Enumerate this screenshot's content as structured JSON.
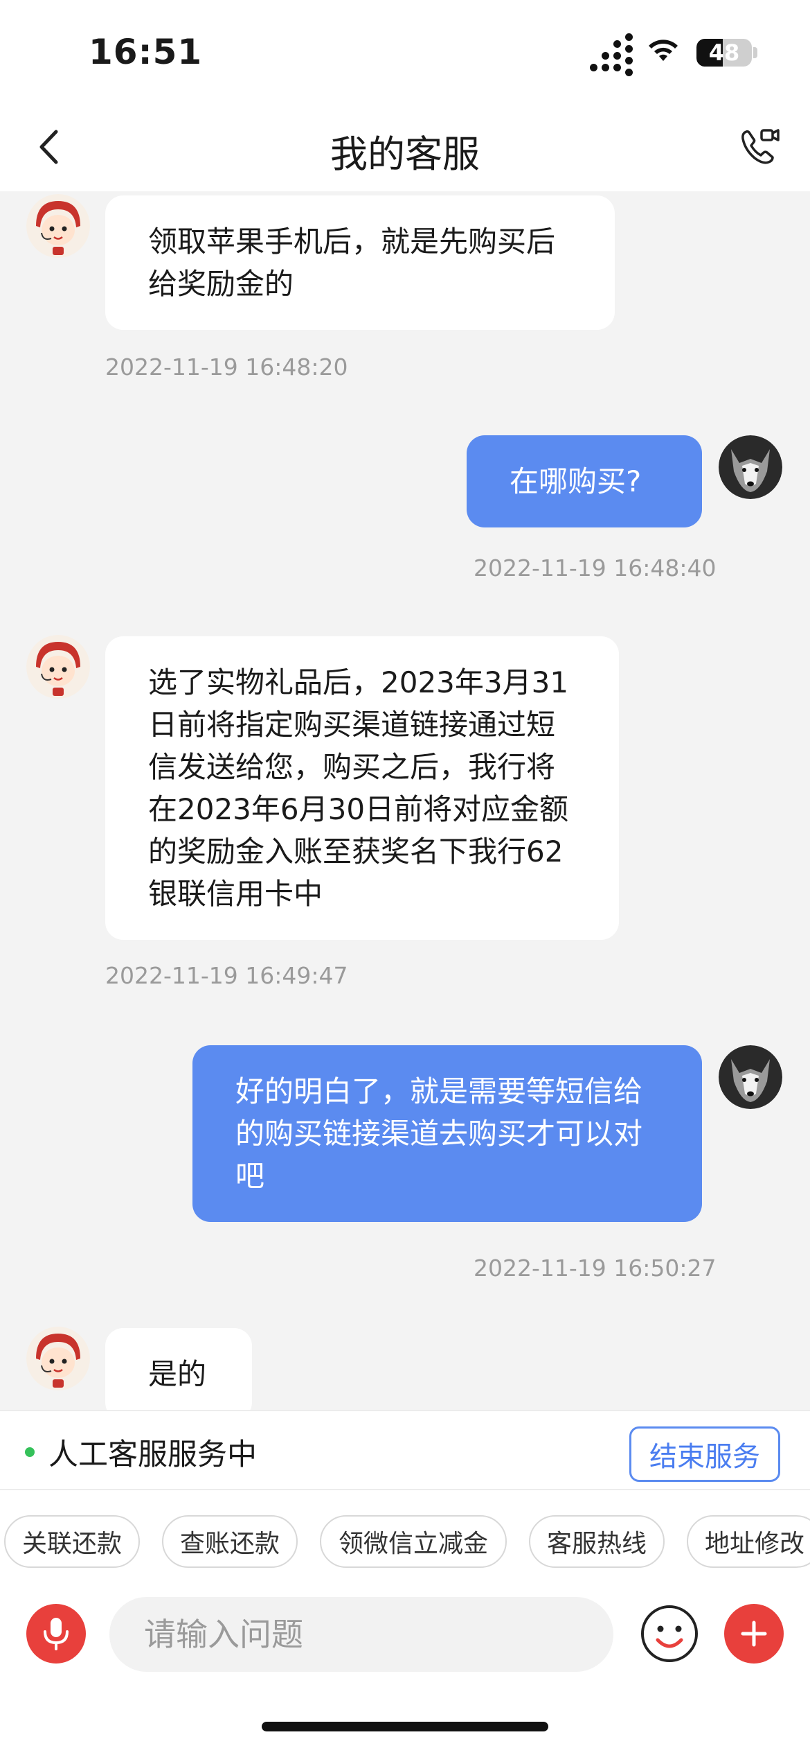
{
  "status_bar": {
    "time": "16:51",
    "battery": "48",
    "battery_level": 0.48
  },
  "nav": {
    "title": "我的客服"
  },
  "messages": [
    {
      "side": "left",
      "text": "领取苹果手机后，就是先购买后给奖励金的",
      "time": "2022-11-19 16:48:20"
    },
    {
      "side": "right",
      "text": "在哪购买?",
      "time": "2022-11-19 16:48:40"
    },
    {
      "side": "left",
      "text": "选了实物礼品后，2023年3月31日前将指定购买渠道链接通过短信发送给您，购买之后，我行将在2023年6月30日前将对应金额的奖励金入账至获奖名下我行62银联信用卡中",
      "time": "2022-11-19 16:49:47"
    },
    {
      "side": "right",
      "text": "好的明白了，就是需要等短信给的购买链接渠道去购买才可以对吧",
      "time": "2022-11-19 16:50:27"
    },
    {
      "side": "left",
      "text": "是的",
      "time": ""
    }
  ],
  "service": {
    "status": "人工客服服务中",
    "end_label": "结束服务"
  },
  "quick_chips": [
    "关联还款",
    "查账还款",
    "领微信立减金",
    "客服热线",
    "地址修改"
  ],
  "input": {
    "placeholder": "请输入问题",
    "value": ""
  },
  "colors": {
    "accent": "#5b8bf0",
    "brand_red": "#e8403c",
    "online": "#35c15a"
  },
  "icons": {
    "back": "chevron-left-icon",
    "call": "phone-video-icon",
    "mic": "mic-icon",
    "emoji": "smile-icon",
    "add": "plus-icon"
  }
}
